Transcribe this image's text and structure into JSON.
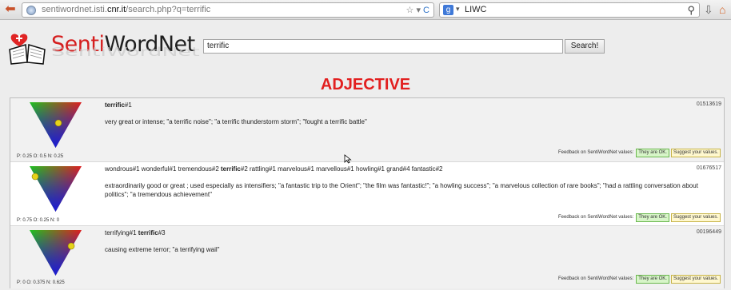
{
  "browser": {
    "url_prefix": "sentiwordnet.isti.",
    "url_domain": "cnr.it",
    "url_path": "/search.php?q=terrific",
    "url_controls": "☆ ▾ ",
    "refresh_glyph": "C",
    "search_engine_letter": "g",
    "search_text": "LIWC"
  },
  "logo": {
    "part1": "Senti",
    "part2": "WordNet"
  },
  "search": {
    "query": "terrific",
    "button_label": "Search!"
  },
  "pos_heading": "ADJECTIVE",
  "entries": [
    {
      "synonyms_before": "",
      "synonym_bold": "terrific",
      "synonyms_after": "#1",
      "offset": "01513619",
      "gloss": "very great or intense; \"a terrific noise\"; \"a terrific thunderstorm storm\"; \"fought a terrific battle\"",
      "score_text": "P: 0.25 O: 0.5 N: 0.25",
      "scores": {
        "positive": 0.25,
        "objective": 0.5,
        "negative": 0.25
      },
      "feedback_label": "Feedback on SentiWordNet values:",
      "ok_label": "They are OK.",
      "suggest_label": "Suggest your values."
    },
    {
      "synonyms_before": "wondrous#1  wonderful#1  tremendous#2  ",
      "synonym_bold": "terrific",
      "synonyms_after": "#2  rattling#1  marvelous#1  marvellous#1  howling#1  grand#4  fantastic#2",
      "offset": "01676517",
      "gloss": "extraordinarily good or great ; used especially as intensifiers; \"a fantastic trip to the Orient\"; \"the film was fantastic!\"; \"a howling success\"; \"a marvelous collection of rare books\"; \"had a rattling conversation about politics\"; \"a tremendous achievement\"",
      "score_text": "P: 0.75 O: 0.25 N: 0",
      "scores": {
        "positive": 0.75,
        "objective": 0.25,
        "negative": 0
      },
      "feedback_label": "Feedback on SentiWordNet values:",
      "ok_label": "They are OK.",
      "suggest_label": "Suggest your values."
    },
    {
      "synonyms_before": "terrifying#1  ",
      "synonym_bold": "terrific",
      "synonyms_after": "#3",
      "offset": "00196449",
      "gloss": "causing extreme terror; \"a terrifying wail\"",
      "score_text": "P: 0 O: 0.375 N: 0.625",
      "scores": {
        "positive": 0,
        "objective": 0.375,
        "negative": 0.625
      },
      "feedback_label": "Feedback on SentiWordNet values:",
      "ok_label": "They are OK.",
      "suggest_label": "Suggest your values."
    }
  ]
}
